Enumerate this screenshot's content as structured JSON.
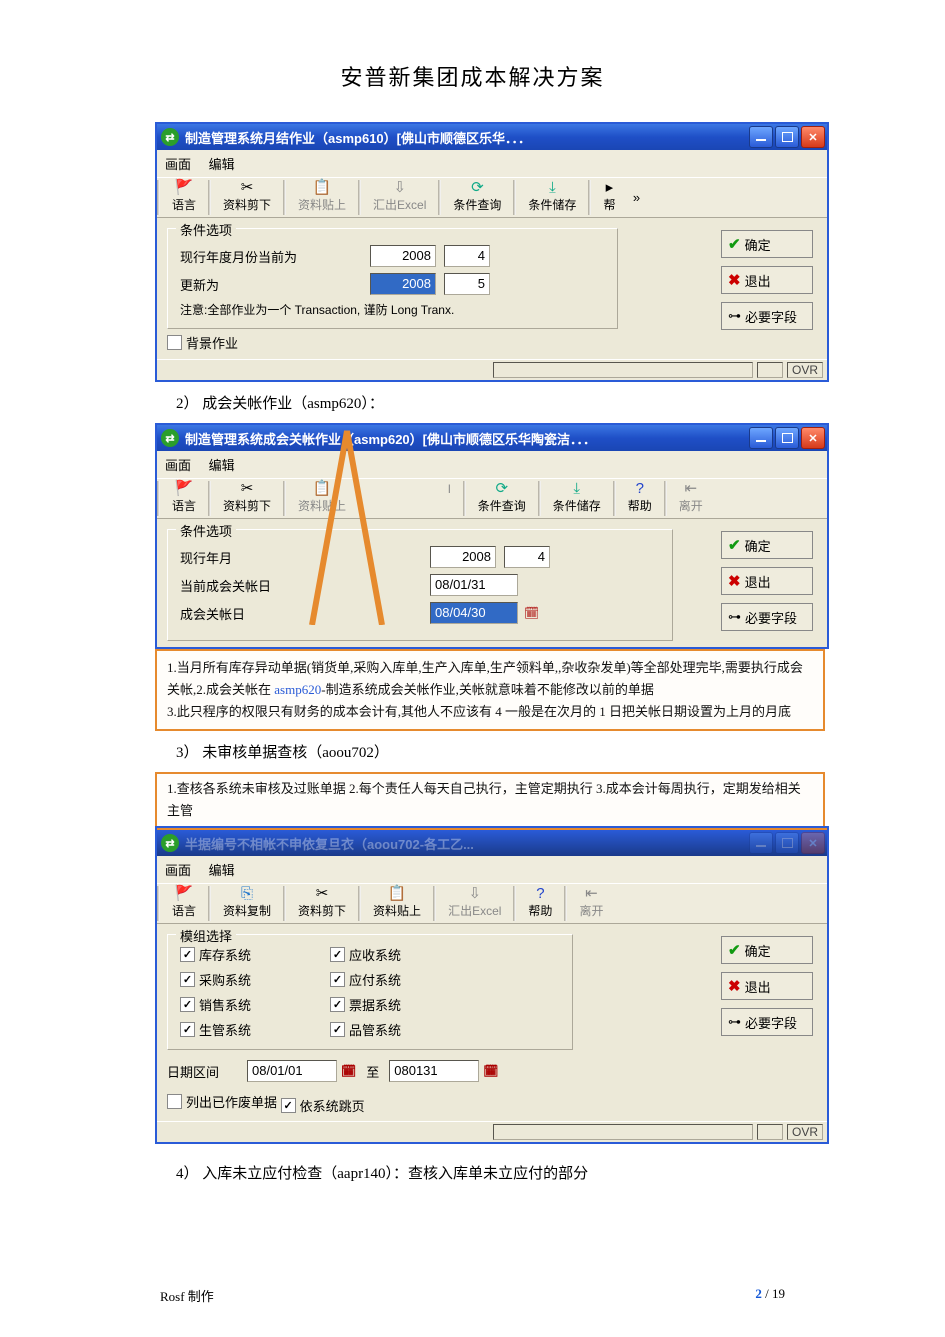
{
  "doc": {
    "header": "安普新集团成本解决方案",
    "item2": "2） 成会关帐作业（asmp620）：",
    "item3": "3） 未审核单据查核（aoou702）",
    "item4": "4） 入库未立应付检查（aapr140）：查核入库单未立应付的部分",
    "footer_left": "Rosf 制作",
    "footer_page_cur": "2",
    "footer_page_sep": " / ",
    "footer_page_total": "19"
  },
  "win1": {
    "title": "制造管理系统月结作业（asmp610）[佛山市顺德区乐华．．．",
    "menu": {
      "m1": "画面",
      "m2": "编辑"
    },
    "tb": {
      "lang": "语言",
      "cut": "资料剪下",
      "paste": "资料贴上",
      "excel": "汇出Excel",
      "query": "条件查询",
      "save": "条件储存",
      "help_char": "帮"
    },
    "group_legend": "条件选项",
    "row1_label": "现行年度月份当前为",
    "row1_year": "2008",
    "row1_month": "4",
    "row2_label": "更新为",
    "row2_year": "2008",
    "row2_month": "5",
    "note": "注意:全部作业为一个 Transaction, 谨防 Long Tranx.",
    "bg_label": "背景作业",
    "ok": "确定",
    "exit": "退出",
    "req": "必要字段",
    "ovr": "OVR"
  },
  "win2": {
    "title": "制造管理系统成会关帐作业（asmp620）[佛山市顺德区乐华陶瓷洁．．．",
    "menu": {
      "m1": "画面",
      "m2": "编辑"
    },
    "tb": {
      "lang": "语言",
      "cut": "资料剪下",
      "paste": "资料贴上",
      "l_frag": "l",
      "query": "条件查询",
      "save": "条件储存",
      "help": "帮助",
      "leave": "离开"
    },
    "group_legend": "条件选项",
    "row1_label": "现行年月",
    "row1_year": "2008",
    "row1_month": "4",
    "row2_label": "当前成会关帐日",
    "row2_val": "08/01/31",
    "row3_label": "成会关帐日",
    "row3_val": "08/04/30",
    "ok": "确定",
    "exit": "退出",
    "req_frag": "必要字段"
  },
  "callout1": {
    "l1a": "1.当月所有库存异动单据(销货单,采购入库单,生产入库单,生产领料单,,杂收杂发单)等全部处理完毕,需要执行成会关帐,",
    "l1b": "2.成会关帐在 ",
    "l1b_code": "asmp620",
    "l1b2": "-制造系统成会关帐作业,关帐就意味着不能修改以前的单据",
    "l2": "3.此只程序的权限只有财务的成本会计有,其他人不应该有 4 一般是在次月的 1 日把关帐日期设置为上月的月底"
  },
  "callout2": {
    "text": "1.查核各系统未审核及过账单据 2.每个责任人每天自己执行，主管定期执行 3.成本会计每周执行，定期发给相关主管"
  },
  "win3": {
    "title_frag": "半据编号不相帐不申依复旦衣（aoou702-各工乙...",
    "menu": {
      "m1": "画面",
      "m2": "编辑"
    },
    "tb": {
      "lang": "语言",
      "copy": "资料复制",
      "cut": "资料剪下",
      "paste": "资料贴上",
      "excel": "汇出Excel",
      "help": "帮助",
      "leave": "离开"
    },
    "group_legend": "模组选择",
    "mods": {
      "inv": "库存系统",
      "ar": "应收系统",
      "po": "采购系统",
      "ap": "应付系统",
      "so": "销售系统",
      "note": "票据系统",
      "mfg": "生管系统",
      "qc": "品管系统"
    },
    "date_label": "日期区间",
    "date_from": "08/01/01",
    "date_to_label": "至",
    "date_to": "080131",
    "cb1": "列出已作废单据",
    "cb2": "依系统跳页",
    "ok": "确定",
    "exit": "退出",
    "req": "必要字段",
    "ovr": "OVR"
  }
}
